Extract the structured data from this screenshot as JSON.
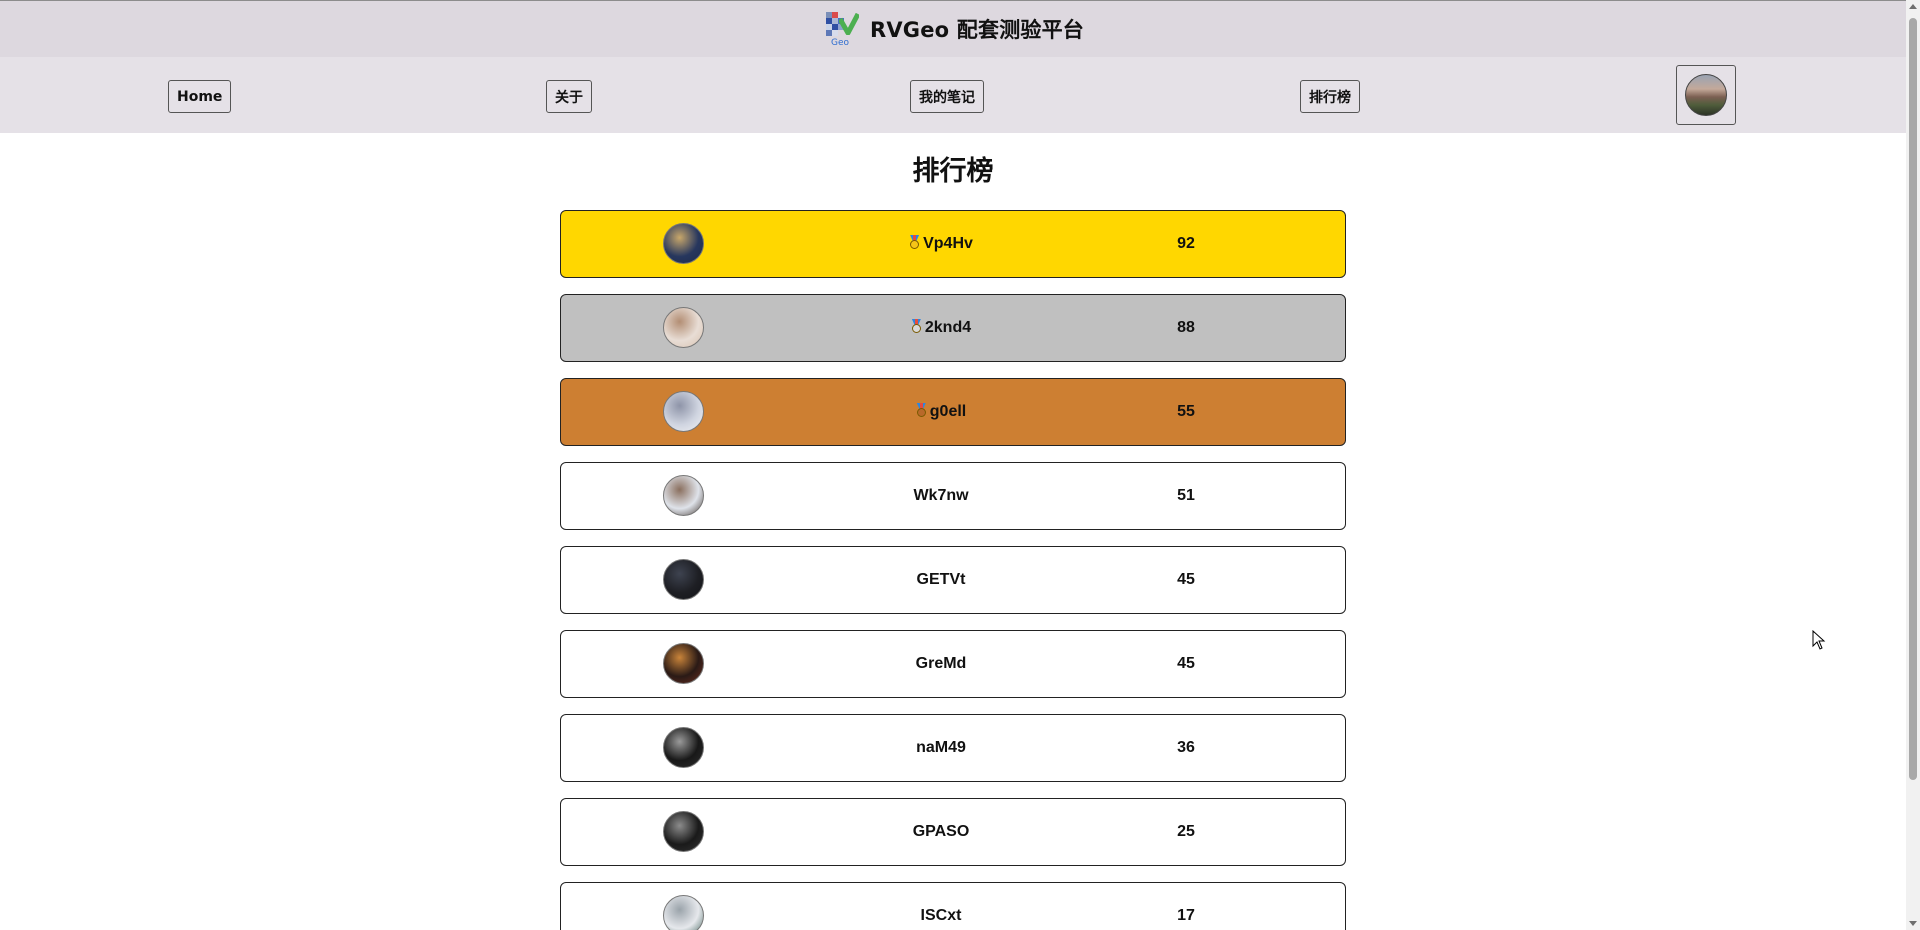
{
  "header": {
    "app_title": "RVGeo 配套测验平台",
    "logo_sub": "Geo"
  },
  "nav": {
    "items": [
      {
        "label": "Home"
      },
      {
        "label": "关于"
      },
      {
        "label": "我的笔记"
      },
      {
        "label": "排行榜"
      }
    ],
    "avatar": "user-avatar"
  },
  "leaderboard": {
    "title": "排行榜",
    "rows": [
      {
        "name": "Vp4Hv",
        "score": "92",
        "medal": "gold-medal-icon",
        "highlight": "#ffd700",
        "avatar_colors": [
          "#27375e",
          "#c8a76a",
          "#1d2a4a"
        ]
      },
      {
        "name": "2knd4",
        "score": "88",
        "medal": "silver-medal-icon",
        "highlight": "#c0c0c0",
        "avatar_colors": [
          "#e8ddd5",
          "#b38e74",
          "#d9c2b0"
        ]
      },
      {
        "name": "g0ell",
        "score": "55",
        "medal": "bronze-medal-icon",
        "highlight": "#cd7f32",
        "avatar_colors": [
          "#cfd4e0",
          "#8e94a8",
          "#f2f2f4"
        ]
      },
      {
        "name": "Wk7nw",
        "score": "51",
        "medal": "",
        "highlight": "#ffffff",
        "avatar_colors": [
          "#dfe3ea",
          "#8a6f5e",
          "#4a3f39"
        ]
      },
      {
        "name": "GETVt",
        "score": "45",
        "medal": "",
        "highlight": "#ffffff",
        "avatar_colors": [
          "#1e1f24",
          "#3e4350",
          "#121317"
        ]
      },
      {
        "name": "GreMd",
        "score": "45",
        "medal": "",
        "highlight": "#ffffff",
        "avatar_colors": [
          "#2a1a16",
          "#c9843a",
          "#6b2d1e"
        ]
      },
      {
        "name": "naM49",
        "score": "36",
        "medal": "",
        "highlight": "#ffffff",
        "avatar_colors": [
          "#181818",
          "#9a9a9a",
          "#2e2e2e"
        ]
      },
      {
        "name": "GPASO",
        "score": "25",
        "medal": "",
        "highlight": "#ffffff",
        "avatar_colors": [
          "#1a1a1a",
          "#8c8c8c",
          "#333333"
        ]
      },
      {
        "name": "ISCxt",
        "score": "17",
        "medal": "",
        "highlight": "#ffffff",
        "avatar_colors": [
          "#e6e8ec",
          "#9aa3aa",
          "#4a6a64"
        ]
      }
    ]
  },
  "colors": {
    "header_bg": "#ddd8df",
    "nav_bg": "#e5e1e7",
    "gold": "#ffd700",
    "silver": "#c0c0c0",
    "bronze": "#cd7f32"
  }
}
